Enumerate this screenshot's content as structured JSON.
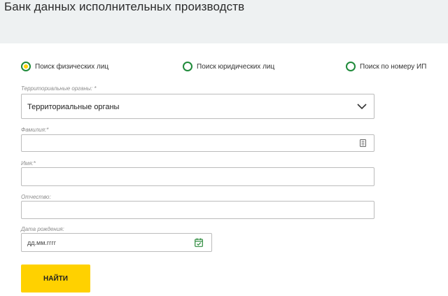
{
  "page": {
    "title": "Банк данных исполнительных производств"
  },
  "search_mode": {
    "options": [
      {
        "label": "Поиск физических лиц",
        "selected": true
      },
      {
        "label": "Поиск юридических лиц",
        "selected": false
      },
      {
        "label": "Поиск по номеру ИП",
        "selected": false
      }
    ]
  },
  "form": {
    "territorial": {
      "label": "Территориальные органы: *",
      "value": "Территориальные органы"
    },
    "surname": {
      "label": "Фамилия:*",
      "value": ""
    },
    "name": {
      "label": "Имя:*",
      "value": ""
    },
    "patronymic": {
      "label": "Отчество:",
      "value": ""
    },
    "dob": {
      "label": "Дата рождения:",
      "placeholder": "дд.мм.гггг"
    },
    "find_label": "НАЙТИ"
  },
  "colors": {
    "accent": "#ffd100",
    "radio_ring": "#1f8a3a",
    "background": "#eef1f2"
  },
  "icons": [
    "chevron-down-icon",
    "contact-card-icon",
    "calendar-icon"
  ]
}
